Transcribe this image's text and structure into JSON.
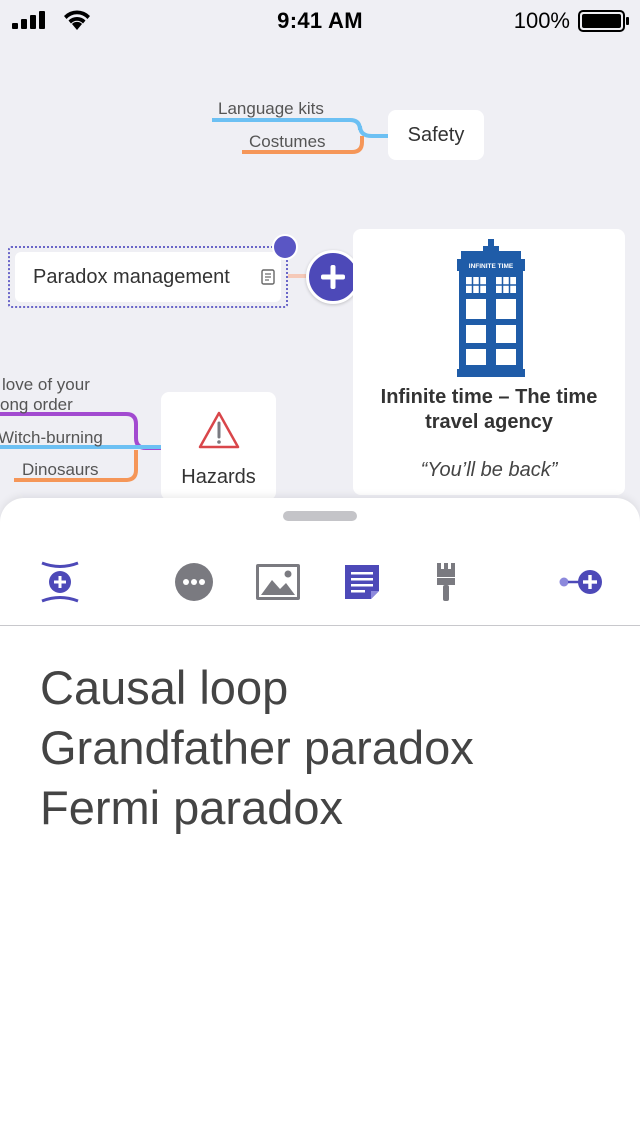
{
  "status_bar": {
    "time": "9:41 AM",
    "battery": "100%"
  },
  "mindmap": {
    "branches": {
      "language_kits": "Language kits",
      "costumes": "Costumes",
      "love_line1": "love of your",
      "love_line2": "ong order",
      "witch_burning": "Witch-burning",
      "dinosaurs": "Dinosaurs"
    },
    "nodes": {
      "safety": "Safety",
      "paradox": "Paradox management",
      "agency_title_line1": "Infinite time – The time",
      "agency_title_line2": "travel agency",
      "agency_quote": "“You’ll be back”",
      "hazards": "Hazards",
      "tardis_sign": "INFINITE TIME"
    }
  },
  "toolbar": {
    "icons": [
      "insert-node-icon",
      "more-icon",
      "image-icon",
      "note-icon",
      "style-brush-icon",
      "add-branch-icon"
    ],
    "accent": "#4d49b8"
  },
  "notes": {
    "lines": [
      "Causal loop",
      "Grandfather paradox",
      "Fermi paradox"
    ]
  },
  "colors": {
    "branch_blue": "#6cc0f3",
    "branch_orange": "#f59658",
    "branch_purple": "#a24ad0",
    "tardis_blue": "#1f5ca8",
    "hazard_red": "#d9464a"
  }
}
